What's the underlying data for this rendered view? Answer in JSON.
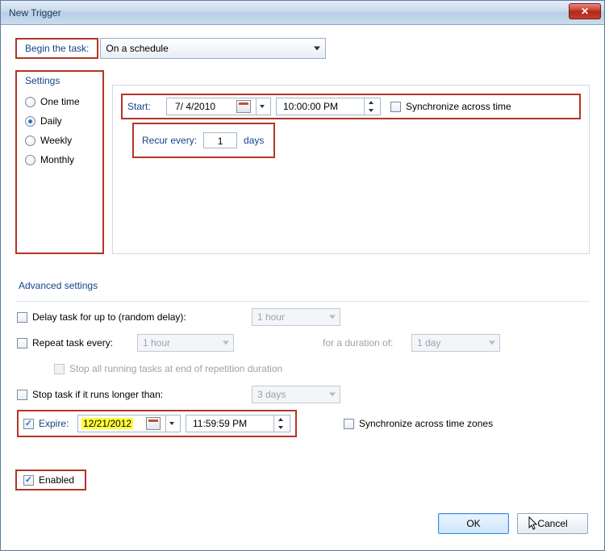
{
  "titlebar": {
    "title": "New Trigger",
    "close": "✕"
  },
  "begin": {
    "label": "Begin the task:",
    "value": "On a schedule"
  },
  "settings": {
    "legend": "Settings",
    "options": {
      "one_time": "One time",
      "daily": "Daily",
      "weekly": "Weekly",
      "monthly": "Monthly"
    },
    "selected": "daily"
  },
  "start": {
    "label": "Start:",
    "date": "7/ 4/2010",
    "time": "10:00:00 PM",
    "sync_label": "Synchronize across time"
  },
  "recur": {
    "prefix": "Recur every:",
    "value": "1",
    "suffix": "days"
  },
  "advanced": {
    "legend": "Advanced settings",
    "delay": {
      "label": "Delay task for up to (random delay):",
      "value": "1 hour"
    },
    "repeat": {
      "label": "Repeat task every:",
      "value": "1 hour",
      "duration_label": "for a duration of:",
      "duration_value": "1 day"
    },
    "stop_all": "Stop all running tasks at end of repetition duration",
    "stop_if": {
      "label": "Stop task if it runs longer than:",
      "value": "3 days"
    },
    "expire": {
      "label": "Expire:",
      "date": "12/21/2012",
      "time": "11:59:59 PM",
      "sync_label": "Synchronize across time zones"
    },
    "enabled_label": "Enabled"
  },
  "buttons": {
    "ok": "OK",
    "cancel": "Cancel"
  }
}
